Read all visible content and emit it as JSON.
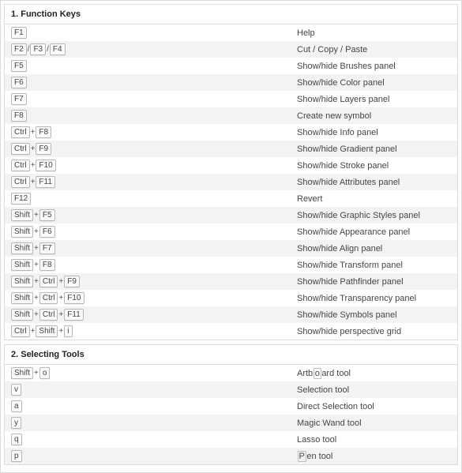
{
  "sections": [
    {
      "title": "1. Function Keys",
      "rows": [
        {
          "keys": [
            [
              "F1"
            ]
          ],
          "desc": "Help"
        },
        {
          "keys": [
            [
              "F2"
            ],
            [
              "F3"
            ],
            [
              "F4"
            ]
          ],
          "joiner": "slash",
          "desc": "Cut / Copy / Paste"
        },
        {
          "keys": [
            [
              "F5"
            ]
          ],
          "desc": "Show/hide Brushes panel"
        },
        {
          "keys": [
            [
              "F6"
            ]
          ],
          "desc": "Show/hide Color panel"
        },
        {
          "keys": [
            [
              "F7"
            ]
          ],
          "desc": "Show/hide Layers panel"
        },
        {
          "keys": [
            [
              "F8"
            ]
          ],
          "desc": "Create new symbol"
        },
        {
          "keys": [
            [
              "Ctrl",
              "F8"
            ]
          ],
          "desc": "Show/hide Info panel"
        },
        {
          "keys": [
            [
              "Ctrl",
              "F9"
            ]
          ],
          "desc": "Show/hide Gradient panel"
        },
        {
          "keys": [
            [
              "Ctrl",
              "F10"
            ]
          ],
          "desc": "Show/hide Stroke panel"
        },
        {
          "keys": [
            [
              "Ctrl",
              "F11"
            ]
          ],
          "desc": "Show/hide Attributes panel"
        },
        {
          "keys": [
            [
              "F12"
            ]
          ],
          "desc": "Revert"
        },
        {
          "keys": [
            [
              "Shift",
              "F5"
            ]
          ],
          "desc": "Show/hide Graphic Styles panel"
        },
        {
          "keys": [
            [
              "Shift",
              "F6"
            ]
          ],
          "desc": "Show/hide Appearance panel"
        },
        {
          "keys": [
            [
              "Shift",
              "F7"
            ]
          ],
          "desc": "Show/hide Align panel"
        },
        {
          "keys": [
            [
              "Shift",
              "F8"
            ]
          ],
          "desc": "Show/hide Transform panel"
        },
        {
          "keys": [
            [
              "Shift",
              "Ctrl",
              "F9"
            ]
          ],
          "desc": "Show/hide Pathfinder panel"
        },
        {
          "keys": [
            [
              "Shift",
              "Ctrl",
              "F10"
            ]
          ],
          "desc": "Show/hide Transparency panel"
        },
        {
          "keys": [
            [
              "Shift",
              "Ctrl",
              "F11"
            ]
          ],
          "desc": "Show/hide Symbols panel"
        },
        {
          "keys": [
            [
              "Ctrl",
              "Shift",
              "i"
            ]
          ],
          "desc": "Show/hide perspective grid"
        }
      ]
    },
    {
      "title": "2. Selecting Tools",
      "rows": [
        {
          "keys": [
            [
              "Shift",
              "o"
            ]
          ],
          "desc_parts": [
            "Artb",
            "o",
            "ard tool"
          ],
          "desc": "Artboard tool"
        },
        {
          "keys": [
            [
              "v"
            ]
          ],
          "desc": "Selection tool"
        },
        {
          "keys": [
            [
              "a"
            ]
          ],
          "desc": "Direct Selection tool"
        },
        {
          "keys": [
            [
              "y"
            ]
          ],
          "desc": "Magic Wand tool"
        },
        {
          "keys": [
            [
              "q"
            ]
          ],
          "desc": "Lasso tool"
        },
        {
          "keys": [
            [
              "p"
            ]
          ],
          "desc_parts": [
            "P",
            "en tool"
          ],
          "desc_hl_first": true,
          "desc": "Pen tool"
        }
      ]
    }
  ]
}
